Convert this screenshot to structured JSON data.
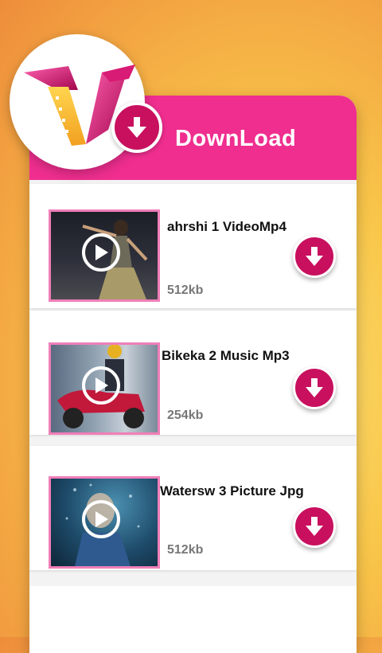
{
  "header": {
    "title": "DownLoad",
    "background_color": "#ef2e8f",
    "logo_icon": "v-logo-icon",
    "logo_badge_icon": "download-icon"
  },
  "items": [
    {
      "title": "ahrshi 1 VideoMp4",
      "size": "512kb",
      "thumbnail": "dancer-image",
      "play_icon": "play-icon",
      "download_icon": "download-icon"
    },
    {
      "title": "Bikeka 2 Music Mp3",
      "size": "254kb",
      "thumbnail": "scooter-rider-image",
      "play_icon": "play-icon",
      "download_icon": "download-icon"
    },
    {
      "title": "Watersw 3 Picture Jpg",
      "size": "512kb",
      "thumbnail": "underwater-person-image",
      "play_icon": "play-icon",
      "download_icon": "download-icon"
    }
  ],
  "colors": {
    "accent": "#c8105f",
    "thumb_border": "#f07fb8"
  }
}
